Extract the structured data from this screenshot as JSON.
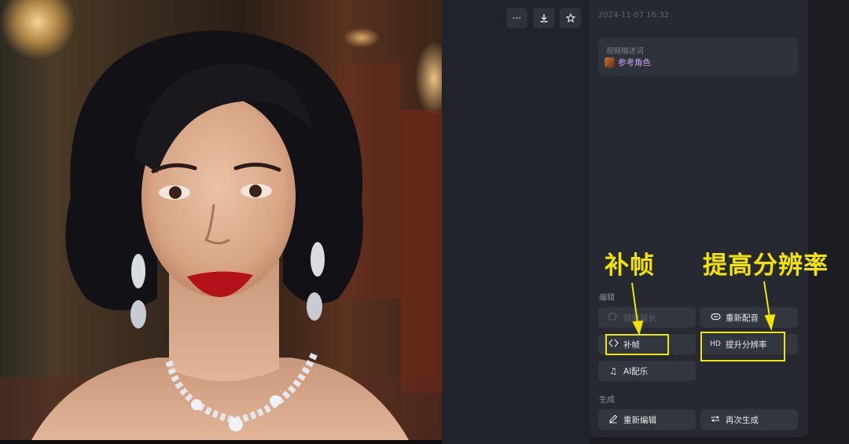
{
  "toolbar": {
    "more_icon": "more-horizontal-icon",
    "download_icon": "download-icon",
    "star_icon": "star-icon"
  },
  "panel": {
    "timestamp": "2024-11-07 16:32",
    "description": {
      "label": "视频描述词",
      "tag": "参考角色"
    },
    "edit_section": {
      "label": "编辑",
      "buttons": [
        {
          "label": "视频延长",
          "icon": "extend-icon",
          "disabled": true
        },
        {
          "label": "重新配音",
          "icon": "dubbing-icon",
          "disabled": false
        },
        {
          "label": "补帧",
          "icon": "frame-interpolation-icon",
          "disabled": false
        },
        {
          "label": "提升分辨率",
          "icon": "hd-icon",
          "icon_text": "HD",
          "disabled": false
        },
        {
          "label": "AI配乐",
          "icon": "music-icon",
          "disabled": false
        }
      ]
    },
    "generate_section": {
      "label": "生成",
      "buttons": [
        {
          "label": "重新编辑",
          "icon": "pencil-icon"
        },
        {
          "label": "再次生成",
          "icon": "repeat-icon"
        }
      ]
    }
  },
  "annotations": {
    "frame_interp": "补帧",
    "upscale": "提高分辨率",
    "color": "#f2e400"
  }
}
